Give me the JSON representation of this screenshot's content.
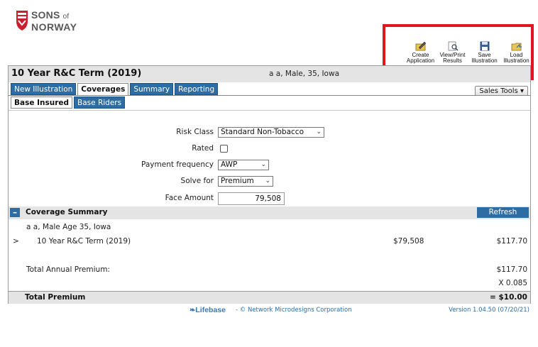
{
  "logo": {
    "line1": "SONS",
    "line1_of": "of",
    "line2": "NORWAY"
  },
  "toolbar": {
    "create_application": "Create Application",
    "view_print_results": "View/Print Results",
    "save_illustration": "Save Illustration",
    "load_illustration": "Load Illustration"
  },
  "header": {
    "title": "10 Year R&C Term (2019)",
    "client": "a a, Male, 35, Iowa"
  },
  "tabs": [
    "New Illustration",
    "Coverages",
    "Summary",
    "Reporting"
  ],
  "active_tab": "Coverages",
  "sales_tools": "Sales Tools ▾",
  "subtabs": [
    "Base Insured",
    "Base Riders"
  ],
  "form": {
    "risk_class_label": "Risk Class",
    "risk_class_value": "Standard Non-Tobacco",
    "rated_label": "Rated",
    "rated_checked": false,
    "payment_frequency_label": "Payment frequency",
    "payment_frequency_value": "AWP",
    "solve_for_label": "Solve for",
    "solve_for_value": "Premium",
    "face_amount_label": "Face Amount",
    "face_amount_value": "79,508"
  },
  "coverage_summary": {
    "collapse_symbol": "–",
    "title": "Coverage Summary",
    "refresh_label": "Refresh",
    "insured_line": "a a, Male Age 35, Iowa",
    "expand_marker": ">",
    "coverage_name": "10 Year R&C Term (2019)",
    "coverage_face": "$79,508",
    "coverage_premium": "$117.70",
    "total_annual_label": "Total Annual Premium:",
    "total_annual_value": "$117.70",
    "modal_factor": "X 0.085",
    "total_premium_label": "Total Premium",
    "total_premium_value": "= $10.00"
  },
  "footer": {
    "lifebase": "Lifebase",
    "copyright": "-  © Network Microdesigns Corporation",
    "version": "Version 1.04.50 (07/20/21)"
  },
  "colors": {
    "accent": "#2e6da4",
    "highlight": "#e0161f",
    "panel": "#e4e4e4"
  }
}
